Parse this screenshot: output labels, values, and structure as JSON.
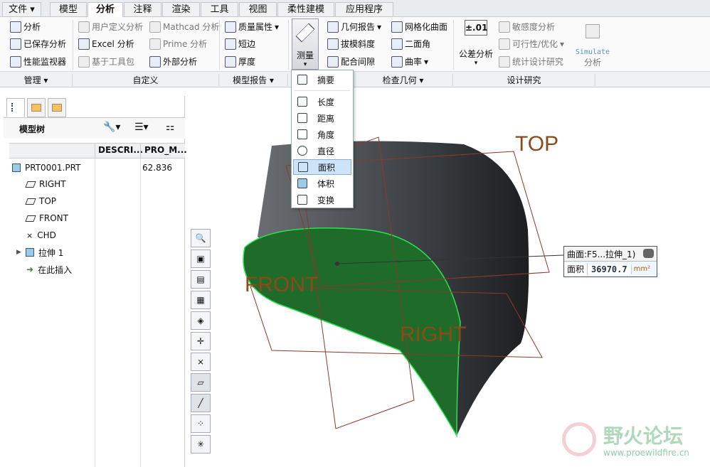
{
  "tabs": [
    "文件",
    "模型",
    "分析",
    "注释",
    "渲染",
    "工具",
    "视图",
    "柔性建模",
    "应用程序"
  ],
  "active_tab": "分析",
  "ribbon": {
    "manage": [
      "分析",
      "已保存分析",
      "性能监视器"
    ],
    "custom": [
      "用户定义分析",
      "Excel 分析",
      "基于工具包",
      "Mathcad 分析",
      "Prime 分析",
      "外部分析"
    ],
    "model_report": [
      "质量属性",
      "短边",
      "厚度"
    ],
    "measure": "测量",
    "inspect": [
      "几何报告",
      "拔模斜度",
      "配合间隙",
      "网格化曲面",
      "二面角",
      "曲率"
    ],
    "tolerance_icon": "±.01",
    "tolerance": "公差分析",
    "design": [
      "敏感度分析",
      "可行性/优化",
      "统计设计研究"
    ],
    "simulate_top": "Simulate",
    "simulate_bottom": "分析",
    "groups": [
      "管理",
      "自定义",
      "模型报告",
      "检查几何",
      "设计研究"
    ]
  },
  "measure_menu": [
    "摘要",
    "长度",
    "距离",
    "角度",
    "直径",
    "面积",
    "体积",
    "变换"
  ],
  "measure_menu_selected": "面积",
  "tree": {
    "title": "模型树",
    "columns": [
      "DESCRI...",
      "PRO_M..."
    ],
    "rows": [
      {
        "label": "PRT0001.PRT",
        "value": "62.836"
      },
      {
        "label": "RIGHT",
        "value": ""
      },
      {
        "label": "TOP",
        "value": ""
      },
      {
        "label": "FRONT",
        "value": ""
      },
      {
        "label": "CHD",
        "value": ""
      },
      {
        "label": "拉伸 1",
        "value": ""
      },
      {
        "label": "在此插入",
        "value": ""
      }
    ]
  },
  "viewport": {
    "planes": [
      "TOP",
      "FRONT",
      "RIGHT"
    ],
    "callout_title": "曲面:F5...拉伸_1)",
    "callout_label": "面积",
    "callout_value": "36970.7",
    "callout_unit": "mm²"
  },
  "watermark": {
    "name": "野火论坛",
    "url": "www.proewildfire.cn"
  }
}
